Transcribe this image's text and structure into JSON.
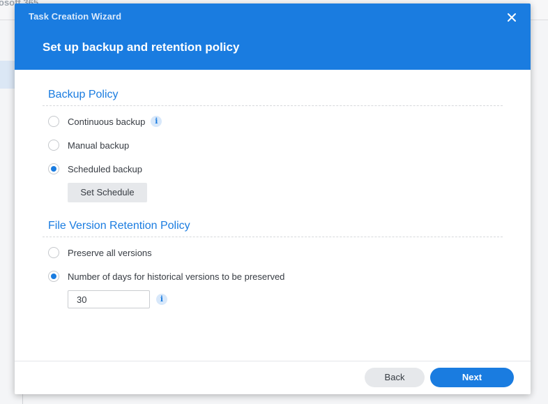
{
  "background": {
    "app_title": "osoft 365"
  },
  "dialog": {
    "wizard_title": "Task Creation Wizard",
    "step_title": "Set up backup and retention policy",
    "close_icon": "close-icon"
  },
  "backup_policy": {
    "title": "Backup Policy",
    "options": [
      {
        "label": "Continuous backup",
        "selected": false,
        "has_info": true
      },
      {
        "label": "Manual backup",
        "selected": false,
        "has_info": false
      },
      {
        "label": "Scheduled backup",
        "selected": true,
        "has_info": false
      }
    ],
    "set_schedule_label": "Set Schedule"
  },
  "retention_policy": {
    "title": "File Version Retention Policy",
    "options": [
      {
        "label": "Preserve all versions",
        "selected": false
      },
      {
        "label": "Number of days for historical versions to be preserved",
        "selected": true
      }
    ],
    "days_value": "30"
  },
  "footer": {
    "back_label": "Back",
    "next_label": "Next"
  },
  "colors": {
    "accent": "#1a7ce0",
    "header_bg": "#1a7ce0",
    "text": "#363b42"
  }
}
